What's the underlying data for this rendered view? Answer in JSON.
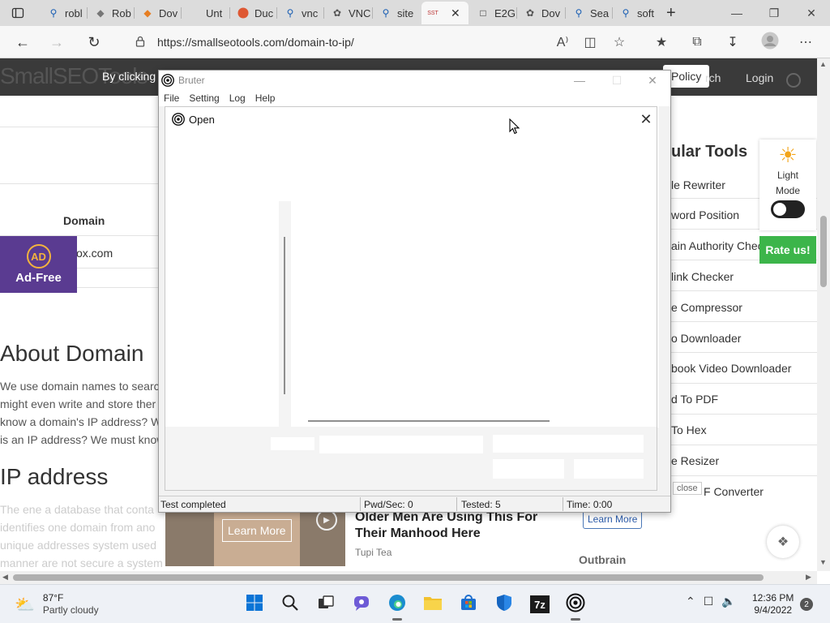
{
  "browser": {
    "tabs": [
      {
        "label": "robl",
        "icon": "search-icon"
      },
      {
        "label": "Rob",
        "icon": "site-icon"
      },
      {
        "label": "Dov",
        "icon": "site-icon"
      },
      {
        "label": "Unt",
        "icon": "blank-page-icon"
      },
      {
        "label": "Duc",
        "icon": "duckduckgo-icon"
      },
      {
        "label": "vnc",
        "icon": "search-icon"
      },
      {
        "label": "VNC",
        "icon": "site-icon"
      },
      {
        "label": "site",
        "icon": "search-icon"
      },
      {
        "label": "",
        "icon": "smallseotools-icon"
      },
      {
        "label": "E2G",
        "icon": "document-icon"
      },
      {
        "label": "Dov",
        "icon": "site-icon"
      },
      {
        "label": "Sea",
        "icon": "search-icon"
      },
      {
        "label": "soft",
        "icon": "search-icon"
      }
    ],
    "active_tab_favicon_text": "SST",
    "url": "https://smallseotools.com/domain-to-ip/"
  },
  "page": {
    "logo": "SmallSEOTools",
    "cookie_text": "By clicking \"",
    "policy_button": "Policy",
    "search_link": "rch",
    "login_link": "Login",
    "table_header": "Domain",
    "table_cell": "ox.com",
    "adfree": {
      "badge": "AD",
      "label": "Ad-Free"
    },
    "about_heading": "About Domain",
    "paragraph_lines": [
      "We use domain names to searc",
      "might even write and store ther",
      "know a domain's IP address? W",
      "is an IP address? We must know"
    ],
    "ip_heading": "IP address",
    "faded_lines": [
      "The ene a database that conta",
      "identifies one domain from ano",
      "unique addresses system used",
      "manner are not secure a system"
    ],
    "tools_title": "ular Tools",
    "tools": [
      "le Rewriter",
      "word Position",
      "ain Authority Chec",
      "link Checker",
      "e Compressor",
      "o Downloader",
      "book Video Downloader",
      "d To PDF",
      "To Hex",
      "e Resizer",
      "F Converter"
    ],
    "light_mode": {
      "line1": "Light",
      "line2": "Mode"
    },
    "rate_button": "Rate us!",
    "ad": {
      "learn_more_image": "Learn More",
      "headline": "Older Men Are Using This For Their Manhood Here",
      "source": "Tupi Tea",
      "learn_more_button": "Learn More",
      "brand": "Outbrain",
      "close_label": "close"
    }
  },
  "bruter": {
    "title": "Bruter",
    "menu": [
      "File",
      "Setting",
      "Log",
      "Help"
    ],
    "status": {
      "state": "Test completed",
      "pwd_sec": "Pwd/Sec: 0",
      "tested": "Tested: 5",
      "time": "Time: 0:00"
    },
    "open_dialog": {
      "title": "Open"
    }
  },
  "taskbar": {
    "weather": {
      "temp": "87°F",
      "condition": "Partly cloudy"
    },
    "time": "12:36 PM",
    "date": "9/4/2022",
    "notifications": "2",
    "apps": [
      "windows-start-icon",
      "search-icon",
      "task-view-icon",
      "chat-icon",
      "edge-icon",
      "file-explorer-icon",
      "store-icon",
      "defender-icon",
      "7zip-icon",
      "bruter-icon"
    ],
    "seven_zip_label": "7z"
  },
  "colors": {
    "header_dark": "#3a3a3a",
    "adfree_purple": "#5a3b91",
    "rate_green": "#3cb54a",
    "taskbar": "#eef1f6"
  }
}
